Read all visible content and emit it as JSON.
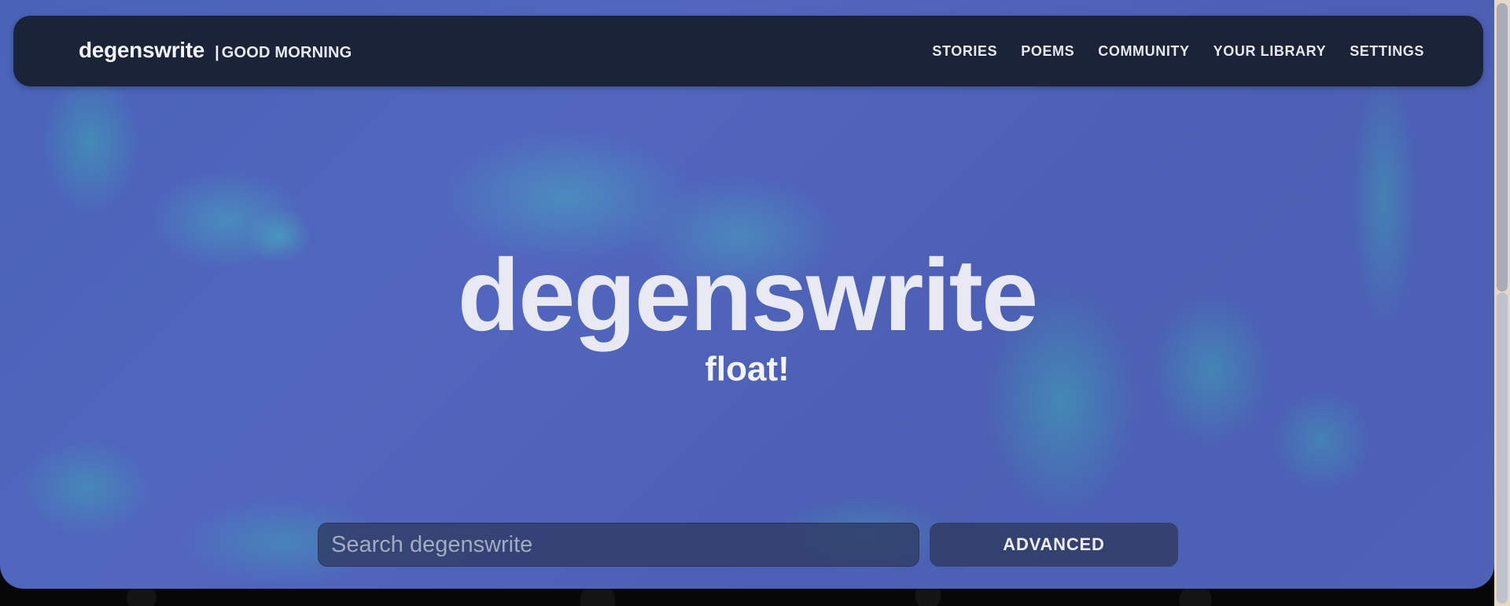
{
  "brand": {
    "name": "degenswrite",
    "separator": "|",
    "greeting": "GOOD MORNING"
  },
  "nav": {
    "items": [
      {
        "label": "STORIES"
      },
      {
        "label": "POEMS"
      },
      {
        "label": "COMMUNITY"
      },
      {
        "label": "YOUR LIBRARY"
      },
      {
        "label": "SETTINGS"
      }
    ]
  },
  "hero": {
    "title": "degenswrite",
    "subtitle": "float!"
  },
  "search": {
    "placeholder": "Search degenswrite",
    "value": "",
    "advanced_label": "ADVANCED"
  },
  "colors": {
    "navbar": "#1a2337",
    "hero_base": "#4d61b7",
    "accent_teal": "#46aabe",
    "text_light": "#e9e9f4"
  }
}
